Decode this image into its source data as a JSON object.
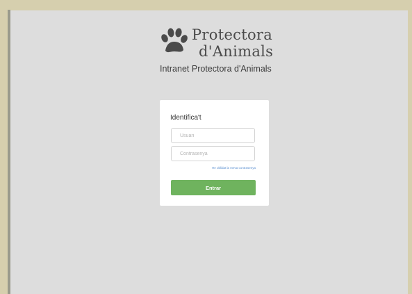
{
  "brand": {
    "name_line1": "Protectora",
    "name_line2": "d'Animals",
    "subtitle": "Intranet Protectora d'Animals",
    "logo_icon": "paw-print-icon"
  },
  "login": {
    "title": "Identifica't",
    "username_placeholder": "Usuari",
    "password_placeholder": "Contrasenya",
    "forgot_link": "He oblidat la meva contrasenya",
    "submit_label": "Entrar"
  },
  "colors": {
    "frame": "#d6cfae",
    "background": "#dddddd",
    "card": "#ffffff",
    "primary_button": "#6fb35e",
    "link": "#5a8fd0"
  }
}
